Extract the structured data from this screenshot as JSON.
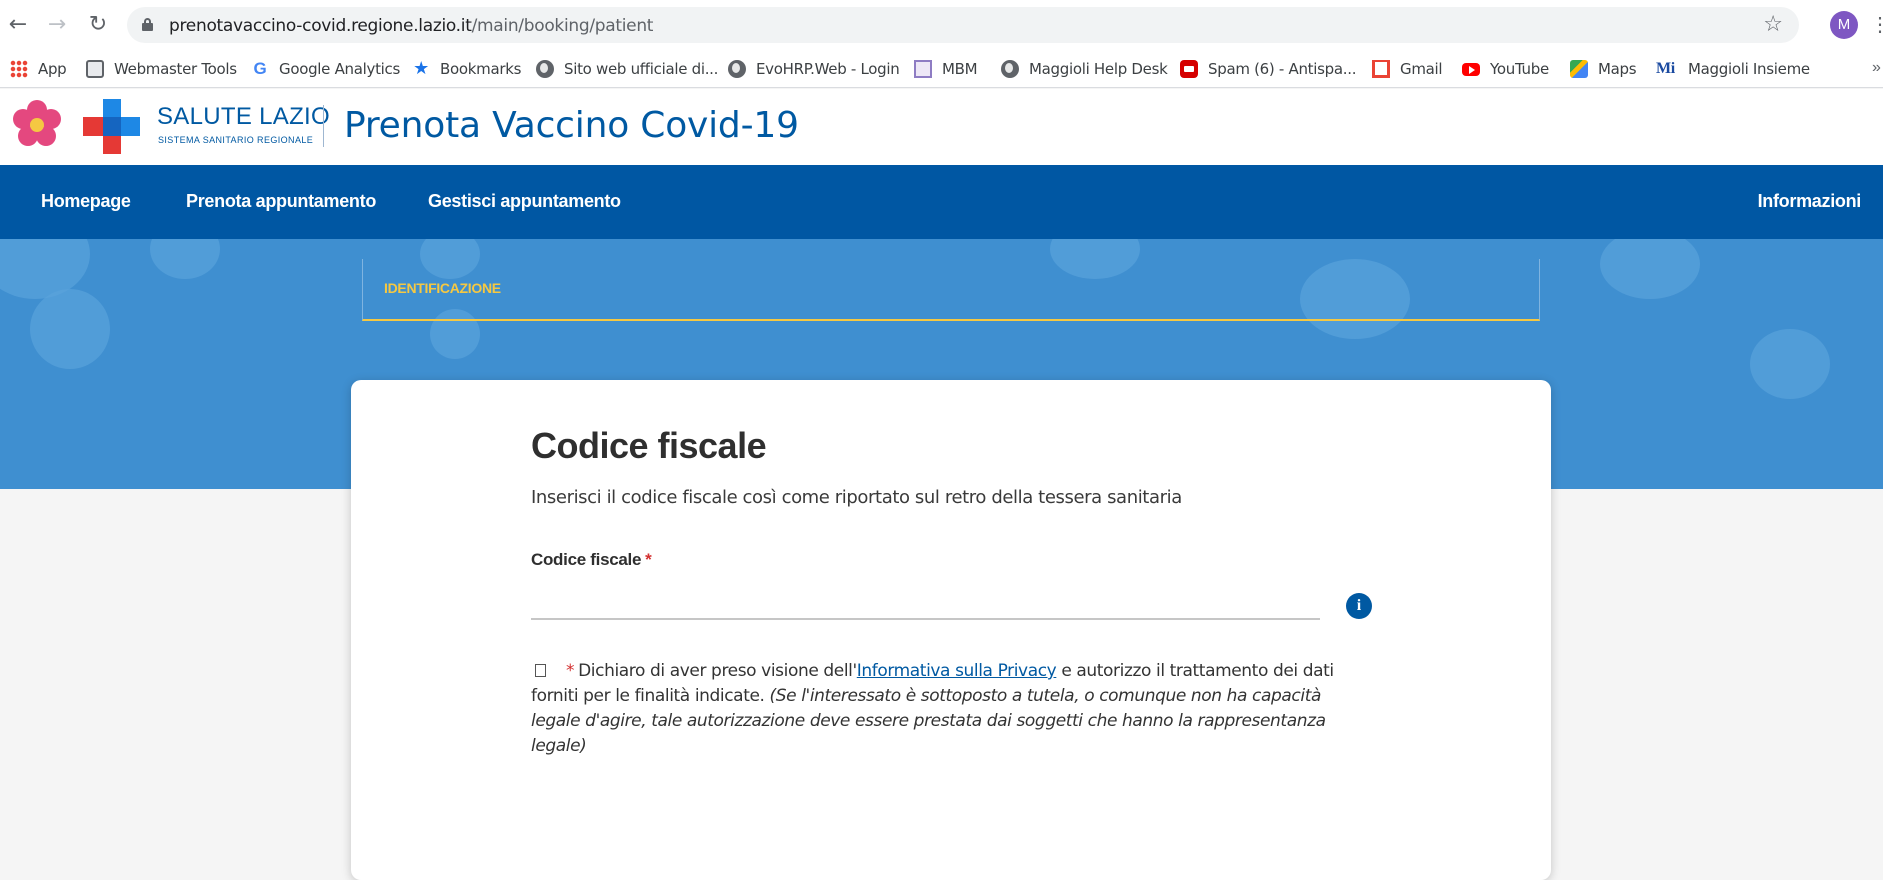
{
  "browser": {
    "url_host": "prenotavaccino-covid.regione.lazio.it",
    "url_path": "/main/booking/patient",
    "profile_initial": "M",
    "bookmarks": [
      {
        "label": "App",
        "icon": "apps-grid-icon"
      },
      {
        "label": "Webmaster Tools",
        "icon": "webmaster-icon"
      },
      {
        "label": "Google Analytics",
        "icon": "google-icon"
      },
      {
        "label": "Bookmarks",
        "icon": "star-icon"
      },
      {
        "label": "Sito web ufficiale di...",
        "icon": "globe-icon"
      },
      {
        "label": "EvoHRP.Web - Login",
        "icon": "globe-icon"
      },
      {
        "label": "MBM",
        "icon": "mbm-icon"
      },
      {
        "label": "Maggioli Help Desk",
        "icon": "globe-icon"
      },
      {
        "label": "Spam (6) - Antispa...",
        "icon": "spam-icon"
      },
      {
        "label": "Gmail",
        "icon": "gmail-icon"
      },
      {
        "label": "YouTube",
        "icon": "youtube-icon"
      },
      {
        "label": "Maps",
        "icon": "maps-icon"
      },
      {
        "label": "Maggioli Insieme",
        "icon": "maggioli-icon"
      }
    ]
  },
  "header": {
    "brand_name": "SALUTE LAZIO",
    "brand_subtitle": "SISTEMA SANITARIO REGIONALE",
    "site_title": "Prenota Vaccino Covid-19"
  },
  "nav": {
    "items": [
      "Homepage",
      "Prenota appuntamento",
      "Gestisci appuntamento"
    ],
    "right_item": "Informazioni"
  },
  "steps": {
    "current": "IDENTIFICAZIONE"
  },
  "form": {
    "title": "Codice fiscale",
    "intro": "Inserisci il codice fiscale così come riportato sul retro della tessera sanitaria",
    "field_label": "Codice fiscale",
    "required_mark": "*",
    "field_value": "",
    "consent_before_link": "Dichiaro di aver preso visione dell'",
    "consent_link": "Informativa sulla Privacy",
    "consent_after_link": " e autorizzo il trattamento dei dati forniti per le finalità indicate. ",
    "consent_note": "(Se l'interessato è sottoposto a tutela, o comunque non ha capacità legale d'agire, tale autorizzazione deve essere prestata dai soggetti che hanno la rappresentanza legale)"
  },
  "colors": {
    "primary": "#0057a3",
    "hero": "#3f8fd0",
    "step_accent": "#f5c842",
    "required": "#d32f2f"
  }
}
